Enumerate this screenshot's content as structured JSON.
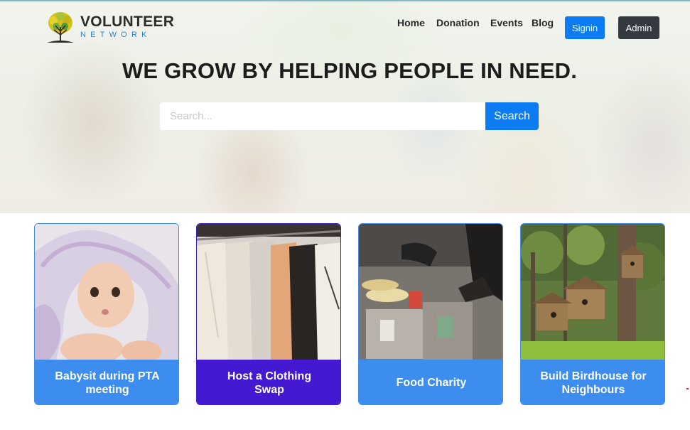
{
  "brand": {
    "title": "VOLUNTEER",
    "subtitle": "NETWORK"
  },
  "nav": {
    "items": [
      "Home",
      "Donation",
      "Events",
      "Blog"
    ],
    "signin": "Signin",
    "admin": "Admin"
  },
  "hero": {
    "headline": "WE GROW BY HELPING PEOPLE IN NEED."
  },
  "search": {
    "placeholder": "Search...",
    "value": "",
    "button": "Search"
  },
  "cards": [
    {
      "title": "Babysit during PTA meeting",
      "image": "baby-photo"
    },
    {
      "title": "Host a Clothing Swap",
      "image": "clothing-rack-photo"
    },
    {
      "title": "Food Charity",
      "image": "food-charity-photo"
    },
    {
      "title": "Build Birdhouse for Neighbours",
      "image": "birdhouse-photo"
    }
  ],
  "colors": {
    "primary": "#0d7cf2",
    "card_blue": "#3c8dee",
    "card_active": "#4518d1",
    "admin": "#343a40"
  }
}
